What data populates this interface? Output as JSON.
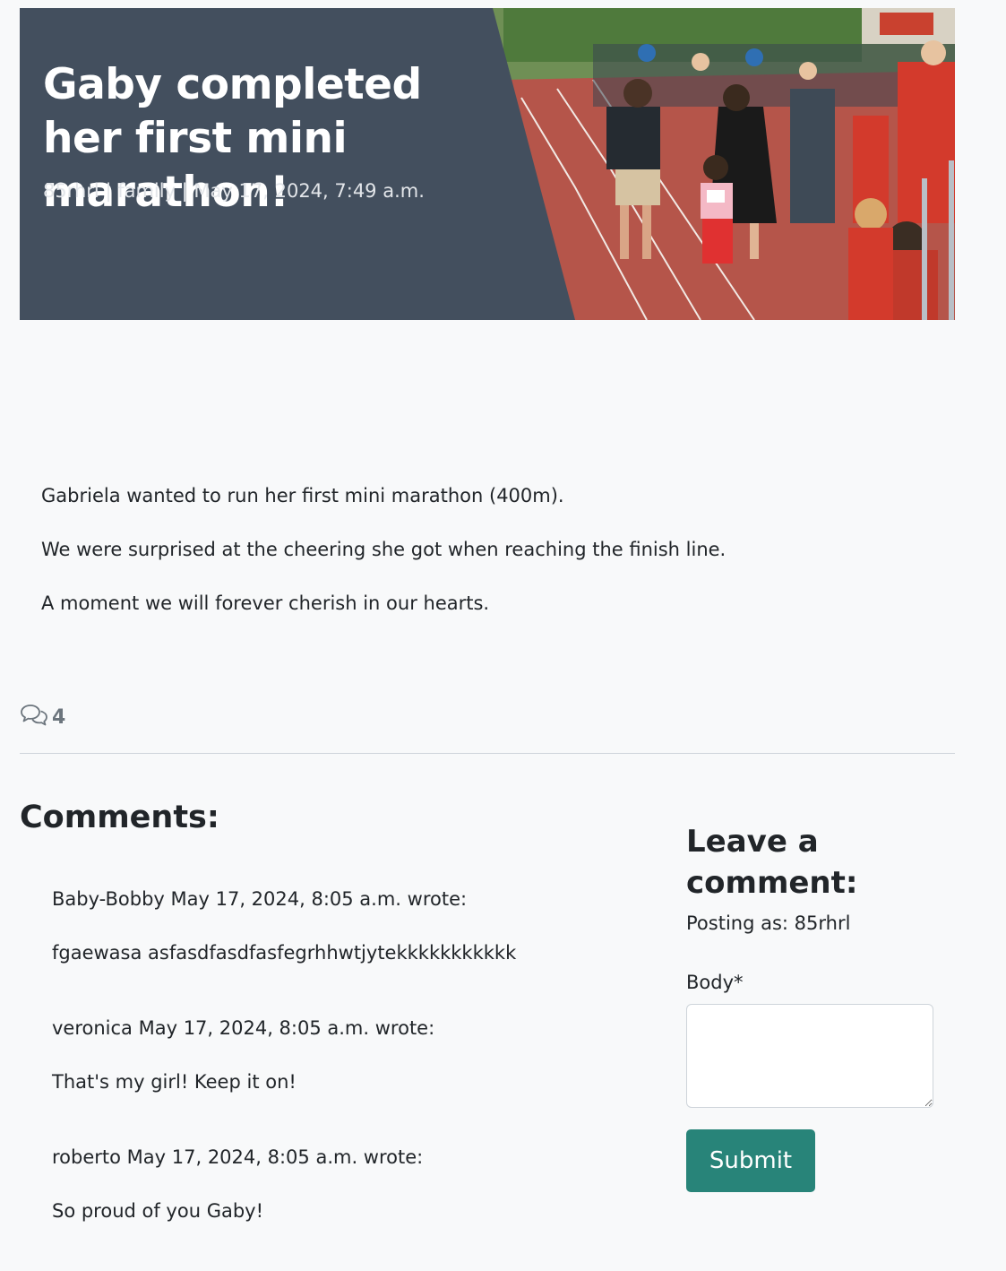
{
  "post": {
    "title": "Gaby completed her first mini marathon!",
    "meta": "85rhrl | family | May 17, 2024, 7:49 a.m.",
    "paragraphs": [
      "Gabriela wanted to run her first mini marathon (400m).",
      "We were surprised at the cheering she got when reaching the finish line.",
      "A moment we will forever cherish in our hearts."
    ],
    "comment_count": "4",
    "comment_icon": "chat-bubbles-icon"
  },
  "comments": {
    "heading": "Comments:",
    "items": [
      {
        "header": "Baby-Bobby May 17, 2024, 8:05 a.m. wrote:",
        "body": "fgaewasa asfasdfasdfasfegrhhwtjytekkkkkkkkkkk"
      },
      {
        "header": "veronica May 17, 2024, 8:05 a.m. wrote:",
        "body": "That's my girl! Keep it on!"
      },
      {
        "header": "roberto May 17, 2024, 8:05 a.m. wrote:",
        "body": "So proud of you Gaby!"
      }
    ]
  },
  "form": {
    "heading": "Leave a comment:",
    "posting_as": "Posting as: 85rhrl",
    "body_label": "Body*",
    "body_value": "",
    "submit_label": "Submit"
  },
  "colors": {
    "hero_panel": "#434f5e",
    "submit_bg": "#288479",
    "track": "#b5554a"
  }
}
